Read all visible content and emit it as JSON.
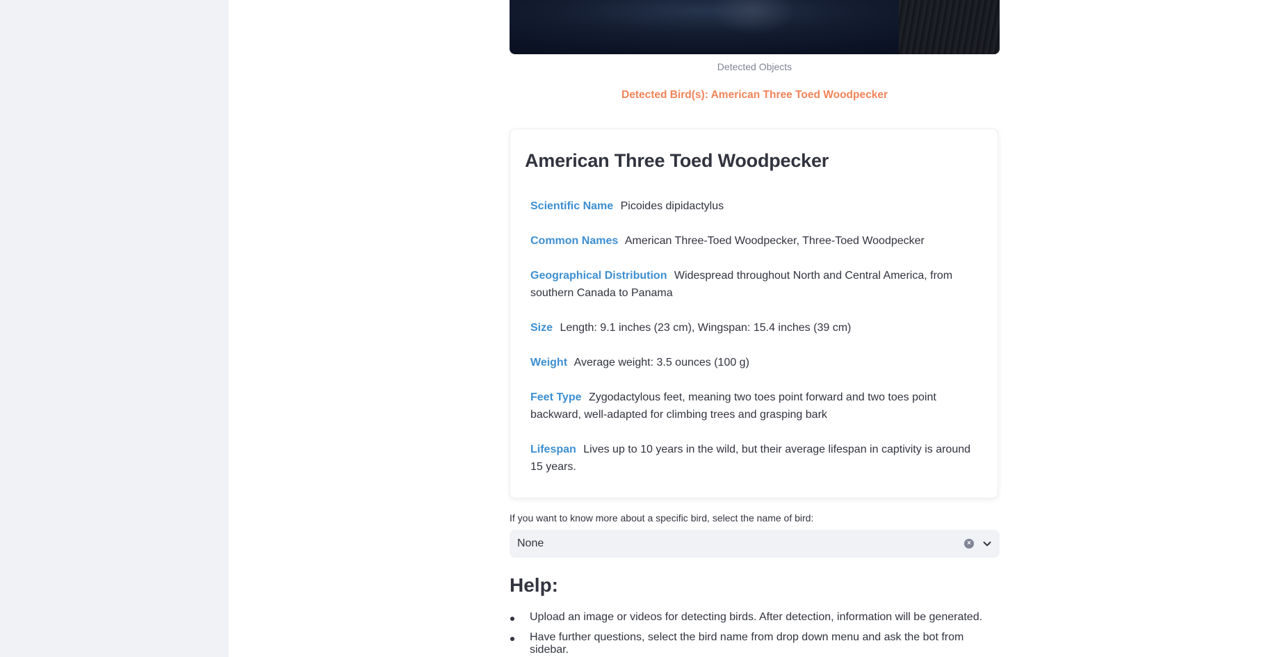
{
  "image_caption": "Detected Objects",
  "detected_text": "Detected Bird(s): American Three Toed Woodpecker",
  "bird_card": {
    "title": "American Three Toed Woodpecker",
    "attributes": [
      {
        "label": "Scientific Name",
        "value": "Picoides dipidactylus"
      },
      {
        "label": "Common Names",
        "value": "American Three-Toed Woodpecker, Three-Toed Woodpecker"
      },
      {
        "label": "Geographical Distribution",
        "value": "Widespread throughout North and Central America, from southern Canada to Panama"
      },
      {
        "label": "Size",
        "value": "Length: 9.1 inches (23 cm), Wingspan: 15.4 inches (39 cm)"
      },
      {
        "label": "Weight",
        "value": "Average weight: 3.5 ounces (100 g)"
      },
      {
        "label": "Feet Type",
        "value": "Zygodactylous feet, meaning two toes point forward and two toes point backward, well-adapted for climbing trees and grasping bark"
      },
      {
        "label": "Lifespan",
        "value": "Lives up to 10 years in the wild, but their average lifespan in captivity is around 15 years."
      }
    ]
  },
  "bird_select": {
    "label": "If you want to know more about a specific bird, select the name of bird:",
    "value": "None"
  },
  "help": {
    "title": "Help:",
    "items": [
      "Upload an image or videos for detecting birds. After detection, information will be generated.",
      "Have further questions, select the bird name from drop down menu and ask the bot from sidebar."
    ]
  },
  "colors": {
    "accent_orange": "#f0845a",
    "attribute_key_blue": "#3d8fd1",
    "sidebar_bg": "#f0f2f6"
  }
}
